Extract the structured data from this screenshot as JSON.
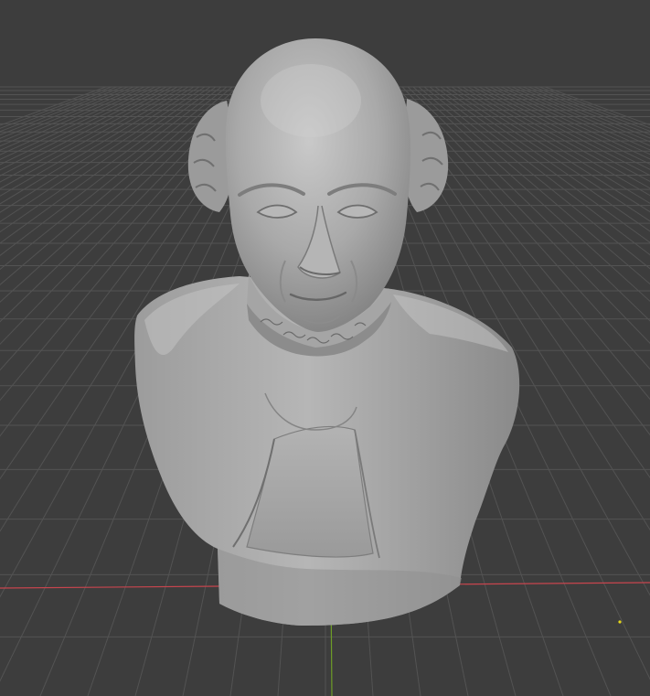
{
  "viewport": {
    "type": "3d-viewport",
    "background_color": "#3d3d3d",
    "grid_color": "#535353",
    "x_axis_color": "#c8454e",
    "y_axis_color": "#6e9d27",
    "origin_marker_color": "#e6d81a"
  },
  "scene": {
    "object": {
      "name_icon": "sculpted-bust-mesh",
      "shading": "solid",
      "base_color": "#9a9a9a"
    }
  }
}
